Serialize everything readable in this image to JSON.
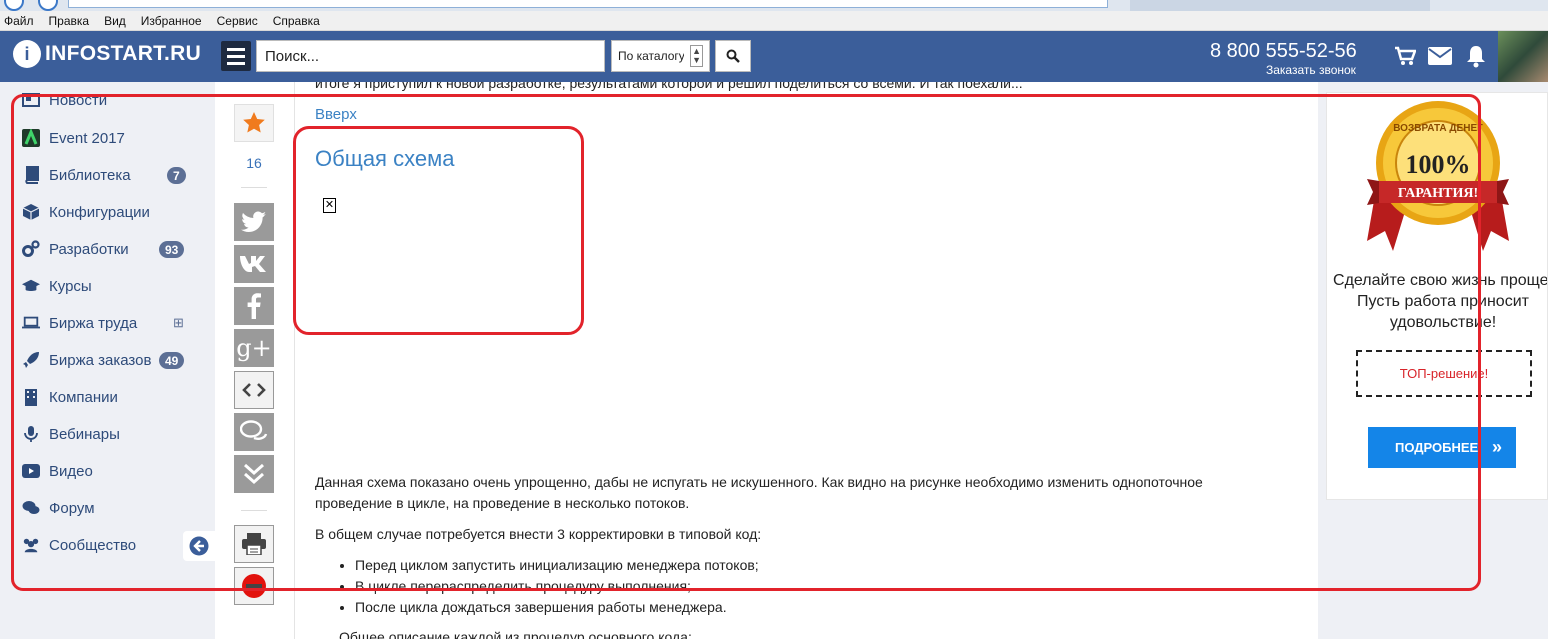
{
  "menubar": {
    "items": [
      "Файл",
      "Правка",
      "Вид",
      "Избранное",
      "Сервис",
      "Справка"
    ]
  },
  "header": {
    "logo_text": "INFOSTART.RU",
    "search_placeholder": "Поиск...",
    "catalog_select": "По каталогу",
    "phone": "8 800 555-52-56",
    "callback": "Заказать звонок",
    "colors": {
      "header_bg": "#3b5e9a",
      "link": "#3b82c4",
      "annotation": "#e2232b"
    }
  },
  "sidebar": {
    "items": [
      {
        "label": "Новости",
        "icon": "newspaper-icon"
      },
      {
        "label": "Event 2017",
        "icon": "event-logo-icon"
      },
      {
        "label": "Библиотека",
        "icon": "book-icon",
        "badge": "7"
      },
      {
        "label": "Конфигурации",
        "icon": "cube-icon"
      },
      {
        "label": "Разработки",
        "icon": "gears-icon",
        "badge": "93"
      },
      {
        "label": "Курсы",
        "icon": "graduation-cap-icon"
      },
      {
        "label": "Биржа труда",
        "icon": "laptop-icon",
        "badge": "⊞"
      },
      {
        "label": "Биржа заказов",
        "icon": "rocket-icon",
        "badge": "49"
      },
      {
        "label": "Компании",
        "icon": "building-icon"
      },
      {
        "label": "Вебинары",
        "icon": "microphone-icon"
      },
      {
        "label": "Видео",
        "icon": "video-icon"
      },
      {
        "label": "Форум",
        "icon": "comments-icon"
      },
      {
        "label": "Сообщество",
        "icon": "users-icon"
      }
    ]
  },
  "share": {
    "favorite_count": "16",
    "buttons": [
      "twitter-icon",
      "vk-icon",
      "facebook-icon",
      "google-plus-icon",
      "embed-code-icon",
      "comments-icon",
      "scroll-down-icon",
      "print-icon",
      "stop-icon"
    ]
  },
  "article": {
    "cut_line": "итоге я приступил к новой разработке, результатами которой и решил поделиться со всеми. И так поехали...",
    "up_link": "Вверх",
    "section_title": "Общая схема",
    "paragraph1": "Данная схема показано очень упрощенно, дабы не испугать не искушенного. Как видно на рисунке необходимо изменить однопоточное проведение в цикле, на проведение в несколько потоков.",
    "paragraph2": "В общем случае потребуется внести 3 корректировки в типовой код:",
    "bullets": [
      "Перед циклом запустить инициализацию менеджера потоков;",
      "В цикле перераспределить процедуру выполнения;",
      "После цикла дождаться завершения работы менеджера."
    ],
    "paragraph3": "Общее описание каждой из процедур основного кода:"
  },
  "banner": {
    "seal_top": "ВОЗВРАТА ДЕНЕГ",
    "seal_percent": "100%",
    "seal_ribbon": "ГАРАНТИЯ!",
    "text": "Сделайте свою жизнь проще. Пусть работа приносит удовольствие!",
    "top_solution": "ТОП-решение!",
    "more_button": "ПОДРОБНЕЕ"
  }
}
